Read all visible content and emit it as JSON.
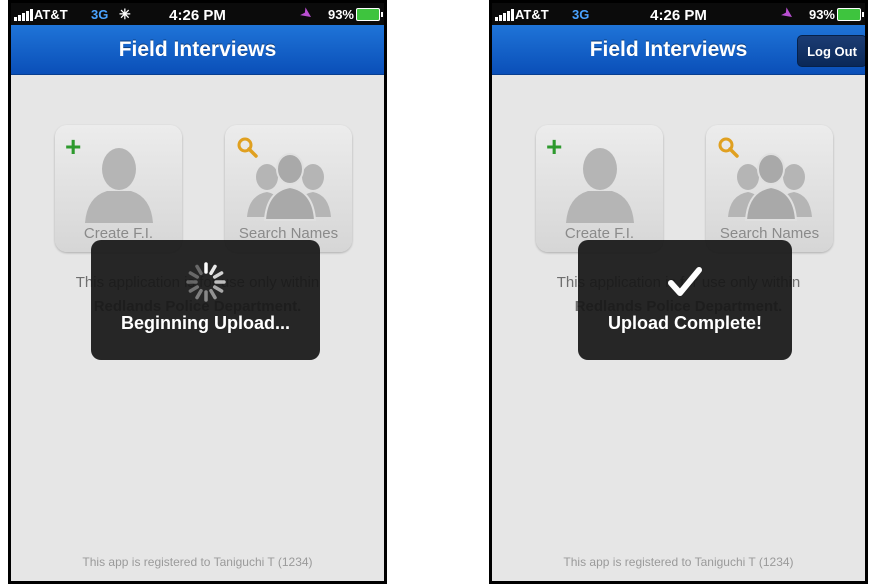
{
  "screens": [
    {
      "status": {
        "carrier": "AT&T",
        "network": "3G",
        "time": "4:26 PM",
        "battery": "93%"
      },
      "nav": {
        "title": "Field Interviews"
      },
      "tiles": [
        {
          "label": "Create F.I.",
          "icon": "add-person-icon"
        },
        {
          "label": "Search Names",
          "icon": "search-people-icon"
        }
      ],
      "description": {
        "line1": "This application is for use only within",
        "line2": "Redlands Police Department."
      },
      "hud": {
        "message": "Beginning Upload...",
        "icon": "spinner-icon"
      },
      "footer": "This app is registered to Taniguchi T (1234)"
    },
    {
      "status": {
        "carrier": "AT&T",
        "network": "3G",
        "time": "4:26 PM",
        "battery": "93%"
      },
      "nav": {
        "title": "Field Interviews",
        "logout_label": "Log Out"
      },
      "tiles": [
        {
          "label": "Create F.I.",
          "icon": "add-person-icon"
        },
        {
          "label": "Search Names",
          "icon": "search-people-icon"
        }
      ],
      "description": {
        "line1": "This application is for use only within",
        "line2": "Redlands Police Department."
      },
      "hud": {
        "message": "Upload Complete!",
        "icon": "checkmark-icon"
      },
      "footer": "This app is registered to Taniguchi T (1234)"
    }
  ],
  "colors": {
    "nav_blue": "#1f74d8",
    "plus_green": "#2e9a2e",
    "search_orange": "#e0a020",
    "hud_bg": "#161616"
  }
}
